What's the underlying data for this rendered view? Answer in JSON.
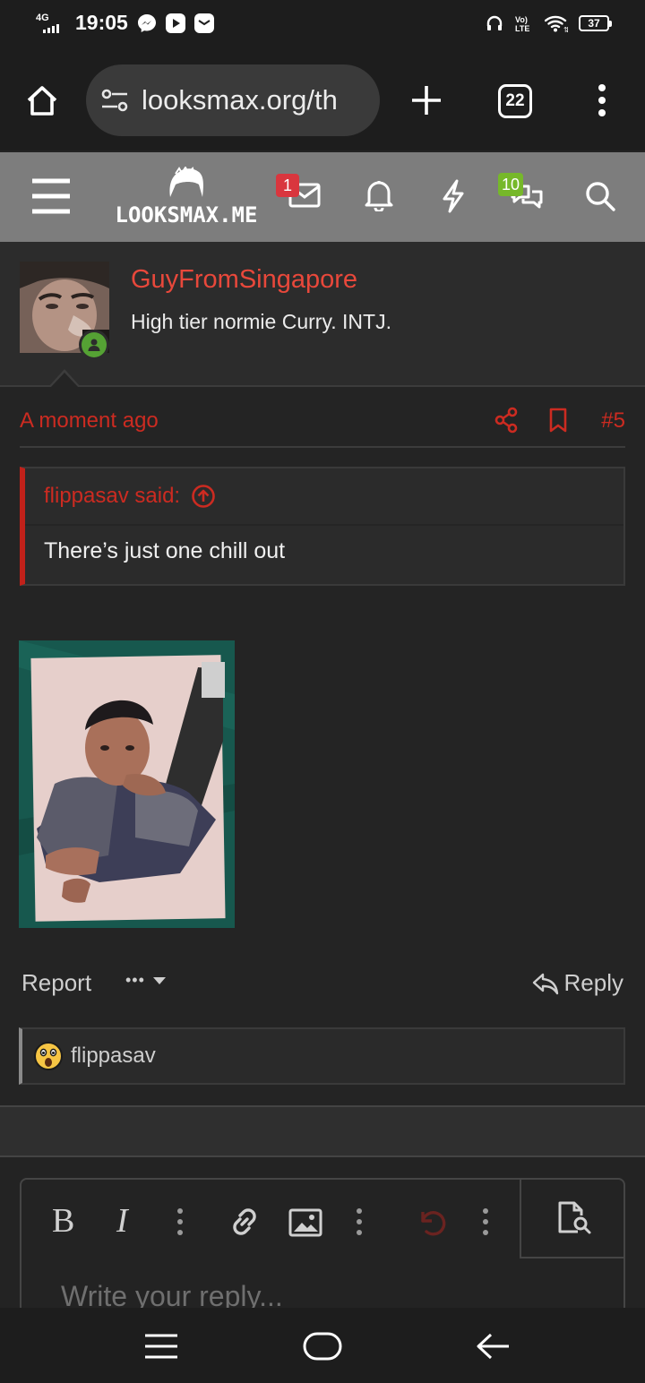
{
  "status_bar": {
    "network": "4G",
    "time": "19:05",
    "battery": "37",
    "volte": "VoLTE"
  },
  "browser": {
    "url": "looksmax.org/th",
    "tab_count": "22"
  },
  "site_header": {
    "logo_text": "LOOKSMAX.ME",
    "inbox_badge": "1",
    "chat_badge": "10"
  },
  "post": {
    "username": "GuyFromSingapore",
    "user_title": "High tier normie Curry. INTJ.",
    "date": "A moment ago",
    "post_number": "#5",
    "quote": {
      "author": "flippasav said:",
      "text": "There’s just one chill out"
    },
    "actions": {
      "report": "Report",
      "more": "•••",
      "reply": "Reply"
    },
    "reactions": {
      "users": "flippasav"
    }
  },
  "editor": {
    "bold": "B",
    "italic": "I",
    "placeholder": "Write your reply..."
  },
  "colors": {
    "accent_red": "#cc2b21",
    "username_red": "#e8483b",
    "header_gray": "#7d7d7d",
    "online_green": "#55a234",
    "badge_green": "#76b82a"
  }
}
